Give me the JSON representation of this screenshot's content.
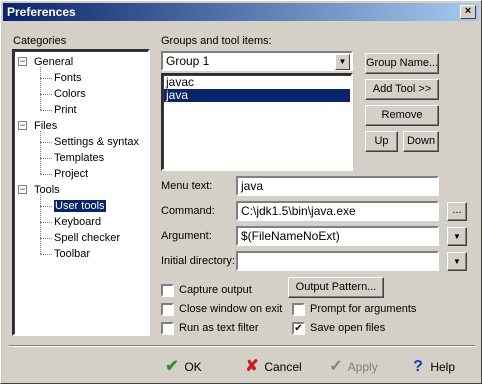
{
  "window": {
    "title": "Preferences",
    "close_glyph": "×"
  },
  "categories": {
    "label": "Categories",
    "tree": [
      {
        "label": "General",
        "expander": "−",
        "children": [
          "Fonts",
          "Colors",
          "Print"
        ]
      },
      {
        "label": "Files",
        "expander": "−",
        "children": [
          "Settings & syntax",
          "Templates",
          "Project"
        ]
      },
      {
        "label": "Tools",
        "expander": "−",
        "children": [
          "User tools",
          "Keyboard",
          "Spell checker",
          "Toolbar"
        ]
      }
    ],
    "selected": "User tools"
  },
  "groups": {
    "label": "Groups and tool items:",
    "selected_group": "Group 1",
    "items": [
      "javac",
      "java"
    ],
    "selected_item": "java"
  },
  "side_buttons": {
    "group_name": "Group Name...",
    "add_tool": "Add Tool >>",
    "remove": "Remove",
    "up": "Up",
    "down": "Down"
  },
  "form": {
    "menu_text_label": "Menu text:",
    "menu_text_value": "java",
    "command_label": "Command:",
    "command_value": "C:\\jdk1.5\\bin\\java.exe",
    "browse_label": "...",
    "argument_label": "Argument:",
    "argument_value": "$(FileNameNoExt)",
    "initial_dir_label": "Initial directory:",
    "initial_dir_value": "",
    "output_pattern": "Output Pattern..."
  },
  "options": {
    "capture_output": {
      "label": "Capture output",
      "checked": false
    },
    "close_window": {
      "label": "Close window on exit",
      "checked": false
    },
    "run_filter": {
      "label": "Run as text filter",
      "checked": false
    },
    "prompt_args": {
      "label": "Prompt for arguments",
      "checked": false
    },
    "save_files": {
      "label": "Save open files",
      "checked": true
    }
  },
  "footer": {
    "ok": "OK",
    "cancel": "Cancel",
    "apply": "Apply",
    "help": "Help",
    "ok_icon": "checkmark-icon",
    "cancel_icon": "x-icon",
    "apply_icon": "check-icon",
    "help_icon": "question-icon"
  },
  "colors": {
    "selection": "#0a246a",
    "title_start": "#0a246a",
    "title_end": "#a6caf0",
    "ok_green": "#2e8b2e",
    "cancel_red": "#c81e1e",
    "help_blue": "#1f3fb0"
  }
}
